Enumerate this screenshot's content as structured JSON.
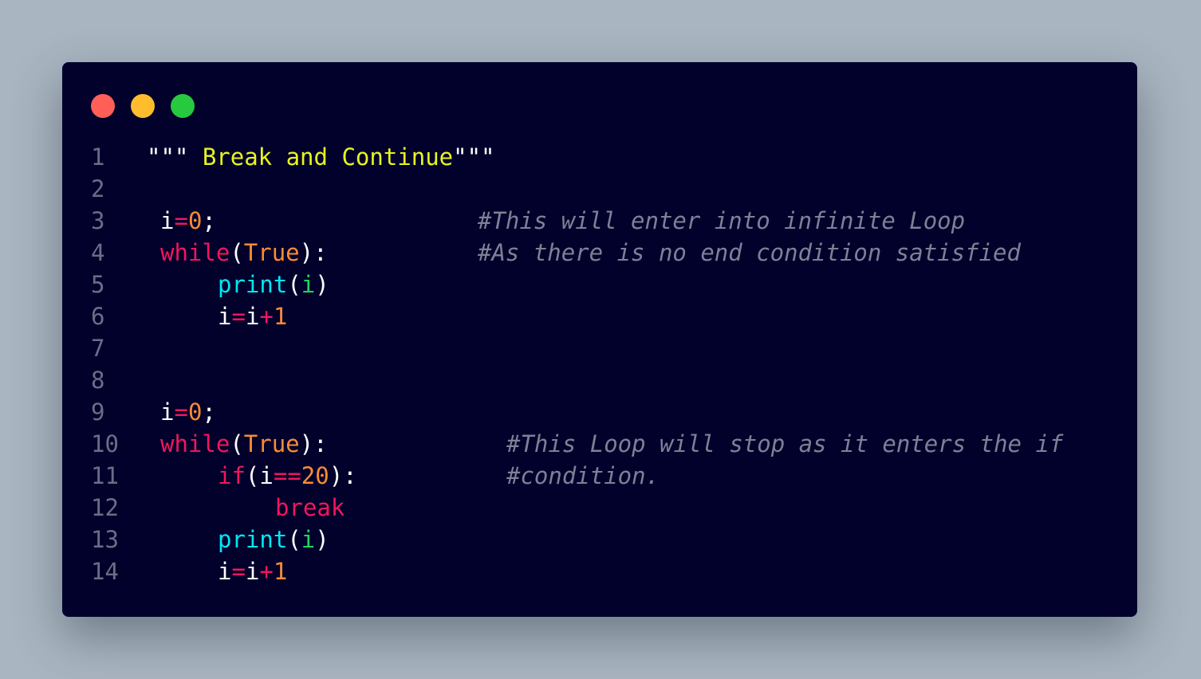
{
  "window": {
    "background": "#01012b",
    "controls": [
      {
        "name": "close",
        "color": "#ff5f56"
      },
      {
        "name": "minimize",
        "color": "#ffbd2e"
      },
      {
        "name": "maximize",
        "color": "#27c93f"
      }
    ]
  },
  "theme": {
    "default": "#ffffff",
    "keyword": "#f0165d",
    "number": "#f98b35",
    "operator": "#f0165d",
    "builtin": "#00e8f5",
    "variable_arg": "#1ed760",
    "string": "#e7f51d",
    "comment": "#7d8196",
    "line_number": "#6a6e86"
  },
  "code": {
    "lines": [
      {
        "number": "1",
        "tokens": [
          {
            "text": "\"\"\" ",
            "type": "default"
          },
          {
            "text": "Break and Continue",
            "type": "string"
          },
          {
            "text": "\"\"\"",
            "type": "default"
          }
        ],
        "comment": ""
      },
      {
        "number": "2",
        "tokens": [],
        "comment": ""
      },
      {
        "number": "3",
        "tokens": [
          {
            "text": "i",
            "type": "default"
          },
          {
            "text": "=",
            "type": "operator"
          },
          {
            "text": "0",
            "type": "number"
          },
          {
            "text": ";",
            "type": "default"
          }
        ],
        "comment": "#This will enter into infinite Loop"
      },
      {
        "number": "4",
        "tokens": [
          {
            "text": "while",
            "type": "keyword"
          },
          {
            "text": "(",
            "type": "default"
          },
          {
            "text": "True",
            "type": "number"
          },
          {
            "text": "):",
            "type": "default"
          }
        ],
        "comment": "#As there is no end condition satisfied"
      },
      {
        "number": "5",
        "tokens": [
          {
            "text": "print",
            "type": "builtin"
          },
          {
            "text": "(",
            "type": "default"
          },
          {
            "text": "i",
            "type": "variable_arg"
          },
          {
            "text": ")",
            "type": "default"
          }
        ],
        "comment": ""
      },
      {
        "number": "6",
        "tokens": [
          {
            "text": "i",
            "type": "default"
          },
          {
            "text": "=",
            "type": "operator"
          },
          {
            "text": "i",
            "type": "default"
          },
          {
            "text": "+",
            "type": "operator"
          },
          {
            "text": "1",
            "type": "number"
          }
        ],
        "comment": ""
      },
      {
        "number": "7",
        "tokens": [],
        "comment": ""
      },
      {
        "number": "8",
        "tokens": [],
        "comment": ""
      },
      {
        "number": "9",
        "tokens": [
          {
            "text": "i",
            "type": "default"
          },
          {
            "text": "=",
            "type": "operator"
          },
          {
            "text": "0",
            "type": "number"
          },
          {
            "text": ";",
            "type": "default"
          }
        ],
        "comment": ""
      },
      {
        "number": "10",
        "tokens": [
          {
            "text": "while",
            "type": "keyword"
          },
          {
            "text": "(",
            "type": "default"
          },
          {
            "text": "True",
            "type": "number"
          },
          {
            "text": "):",
            "type": "default"
          }
        ],
        "comment": "#This Loop will stop as it enters the if"
      },
      {
        "number": "11",
        "tokens": [
          {
            "text": "if",
            "type": "keyword"
          },
          {
            "text": "(",
            "type": "default"
          },
          {
            "text": "i",
            "type": "default"
          },
          {
            "text": "==",
            "type": "operator"
          },
          {
            "text": "20",
            "type": "number"
          },
          {
            "text": "):",
            "type": "default"
          }
        ],
        "comment": "#condition."
      },
      {
        "number": "12",
        "tokens": [
          {
            "text": "break",
            "type": "keyword"
          }
        ],
        "comment": ""
      },
      {
        "number": "13",
        "tokens": [
          {
            "text": "print",
            "type": "builtin"
          },
          {
            "text": "(",
            "type": "default"
          },
          {
            "text": "i",
            "type": "variable_arg"
          },
          {
            "text": ")",
            "type": "default"
          }
        ],
        "comment": ""
      },
      {
        "number": "14",
        "tokens": [
          {
            "text": "i",
            "type": "default"
          },
          {
            "text": "=",
            "type": "operator"
          },
          {
            "text": "i",
            "type": "default"
          },
          {
            "text": "+",
            "type": "operator"
          },
          {
            "text": "1",
            "type": "number"
          }
        ],
        "comment": ""
      }
    ]
  }
}
